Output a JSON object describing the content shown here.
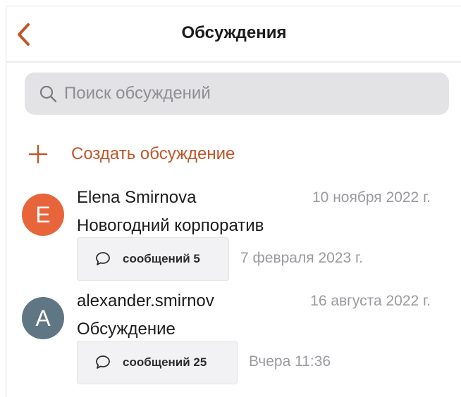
{
  "header": {
    "title": "Обсуждения",
    "back_icon": "chevron-left-icon"
  },
  "search": {
    "placeholder": "Поиск обсуждений",
    "icon": "search-icon"
  },
  "create": {
    "label": "Создать обсуждение",
    "icon": "plus-icon"
  },
  "colors": {
    "accent": "#c0562a",
    "avatar_orange": "#e8643a",
    "avatar_gray": "#5f7684"
  },
  "discussions": [
    {
      "avatar_letter": "E",
      "avatar_color": "#e8643a",
      "author": "Elena Smirnova",
      "date": "10 ноября 2022 г.",
      "subject": "Новогодний корпоратив",
      "messages_label": "сообщений 5",
      "last_date": "7 февраля 2023 г."
    },
    {
      "avatar_letter": "A",
      "avatar_color": "#5f7684",
      "author": "alexander.smirnov",
      "date": "16 августа 2022 г.",
      "subject": "Обсуждение",
      "messages_label": "сообщений 25",
      "last_date": "Вчера 11:36"
    }
  ]
}
